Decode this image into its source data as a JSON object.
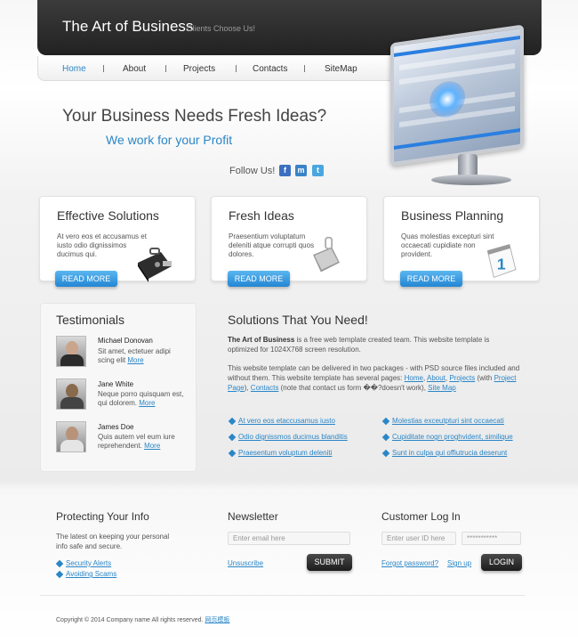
{
  "header": {
    "title": "The Art of Business",
    "tagline": "Clients Choose Us!"
  },
  "nav": {
    "items": [
      "Home",
      "About",
      "Projects",
      "Contacts",
      "SiteMap"
    ],
    "active": "Home"
  },
  "hero": {
    "headline": "Your Business Needs Fresh Ideas?",
    "subheadline": "We work for your Profit",
    "follow_label": "Follow Us!",
    "social_icons": [
      "facebook-icon",
      "myspace-icon",
      "twitter-icon"
    ]
  },
  "features": [
    {
      "title": "Effective Solutions",
      "text": "At vero eos et accusamus et iusto odio dignissimos ducimus qui.",
      "icon": "briefcase-icon",
      "button": "READ MORE"
    },
    {
      "title": "Fresh Ideas",
      "text": "Praesentium voluptatum deleniti atque corrupti quos dolores.",
      "icon": "clipboard-icon",
      "button": "READ MORE"
    },
    {
      "title": "Business Planning",
      "text": "Quas molestias excepturi sint occaecati cupidiate non provident.",
      "icon": "calendar-icon",
      "calendar_number": "1",
      "button": "READ MORE"
    }
  ],
  "testimonials": {
    "title": "Testimonials",
    "items": [
      {
        "name": "Michael Donovan",
        "text": "Sit amet, ectetuer adipi scing elit",
        "link": "More"
      },
      {
        "name": "Jane White",
        "text": "Neque porro quisquam est, qui dolorem.",
        "link": "More"
      },
      {
        "name": "James Doe",
        "text": "Quis autem vel eum iure reprehendent.",
        "link": "More"
      }
    ]
  },
  "solutions": {
    "title": "Solutions That You Need!",
    "intro_bold": "The Art of Business",
    "intro_rest": " is a free web template created team. This website template is optimized for 1024X768 screen resolution.",
    "para2_start": "This website template can be delivered in two packages - with PSD source files included and without them. This website template has several pages: ",
    "pages": [
      "Home",
      "About",
      "Projects"
    ],
    "with_label": " (with ",
    "project_page": "Project Page",
    "after_project": "), ",
    "contacts": "Contacts",
    "note": " (note that contact us form ��?doesn't work), ",
    "sitemap": "Site Map",
    "bullets_left": [
      "At vero eos etaccusamus iusto",
      "Odio dignissmos ducimus blanditis",
      "Praesentum voluptum deleniti"
    ],
    "bullets_right": [
      "Molestias exceutpturi sint occaecati",
      "Cupiditate nogn proghvident, similique",
      "Sunt in culpa qui offiutrucia deserunt"
    ]
  },
  "protect": {
    "title": "Protecting Your Info",
    "text": "The latest on keeping your personal info safe and secure.",
    "links": [
      "Security Alerts",
      "Avoiding Scams"
    ]
  },
  "newsletter": {
    "title": "Newsletter",
    "placeholder": "Enter email here",
    "unsubscribe": "Unsuscribe",
    "button": "SUBMIT"
  },
  "login": {
    "title": "Customer Log In",
    "user_placeholder": "Enter user ID here",
    "password_mask": "***********",
    "forgot": "Forgot password?",
    "signup": "Sign up",
    "button": "LOGIN"
  },
  "footer": {
    "copyright": "Copyright © 2014 Company name All rights reserved.",
    "link": "网页模板"
  }
}
